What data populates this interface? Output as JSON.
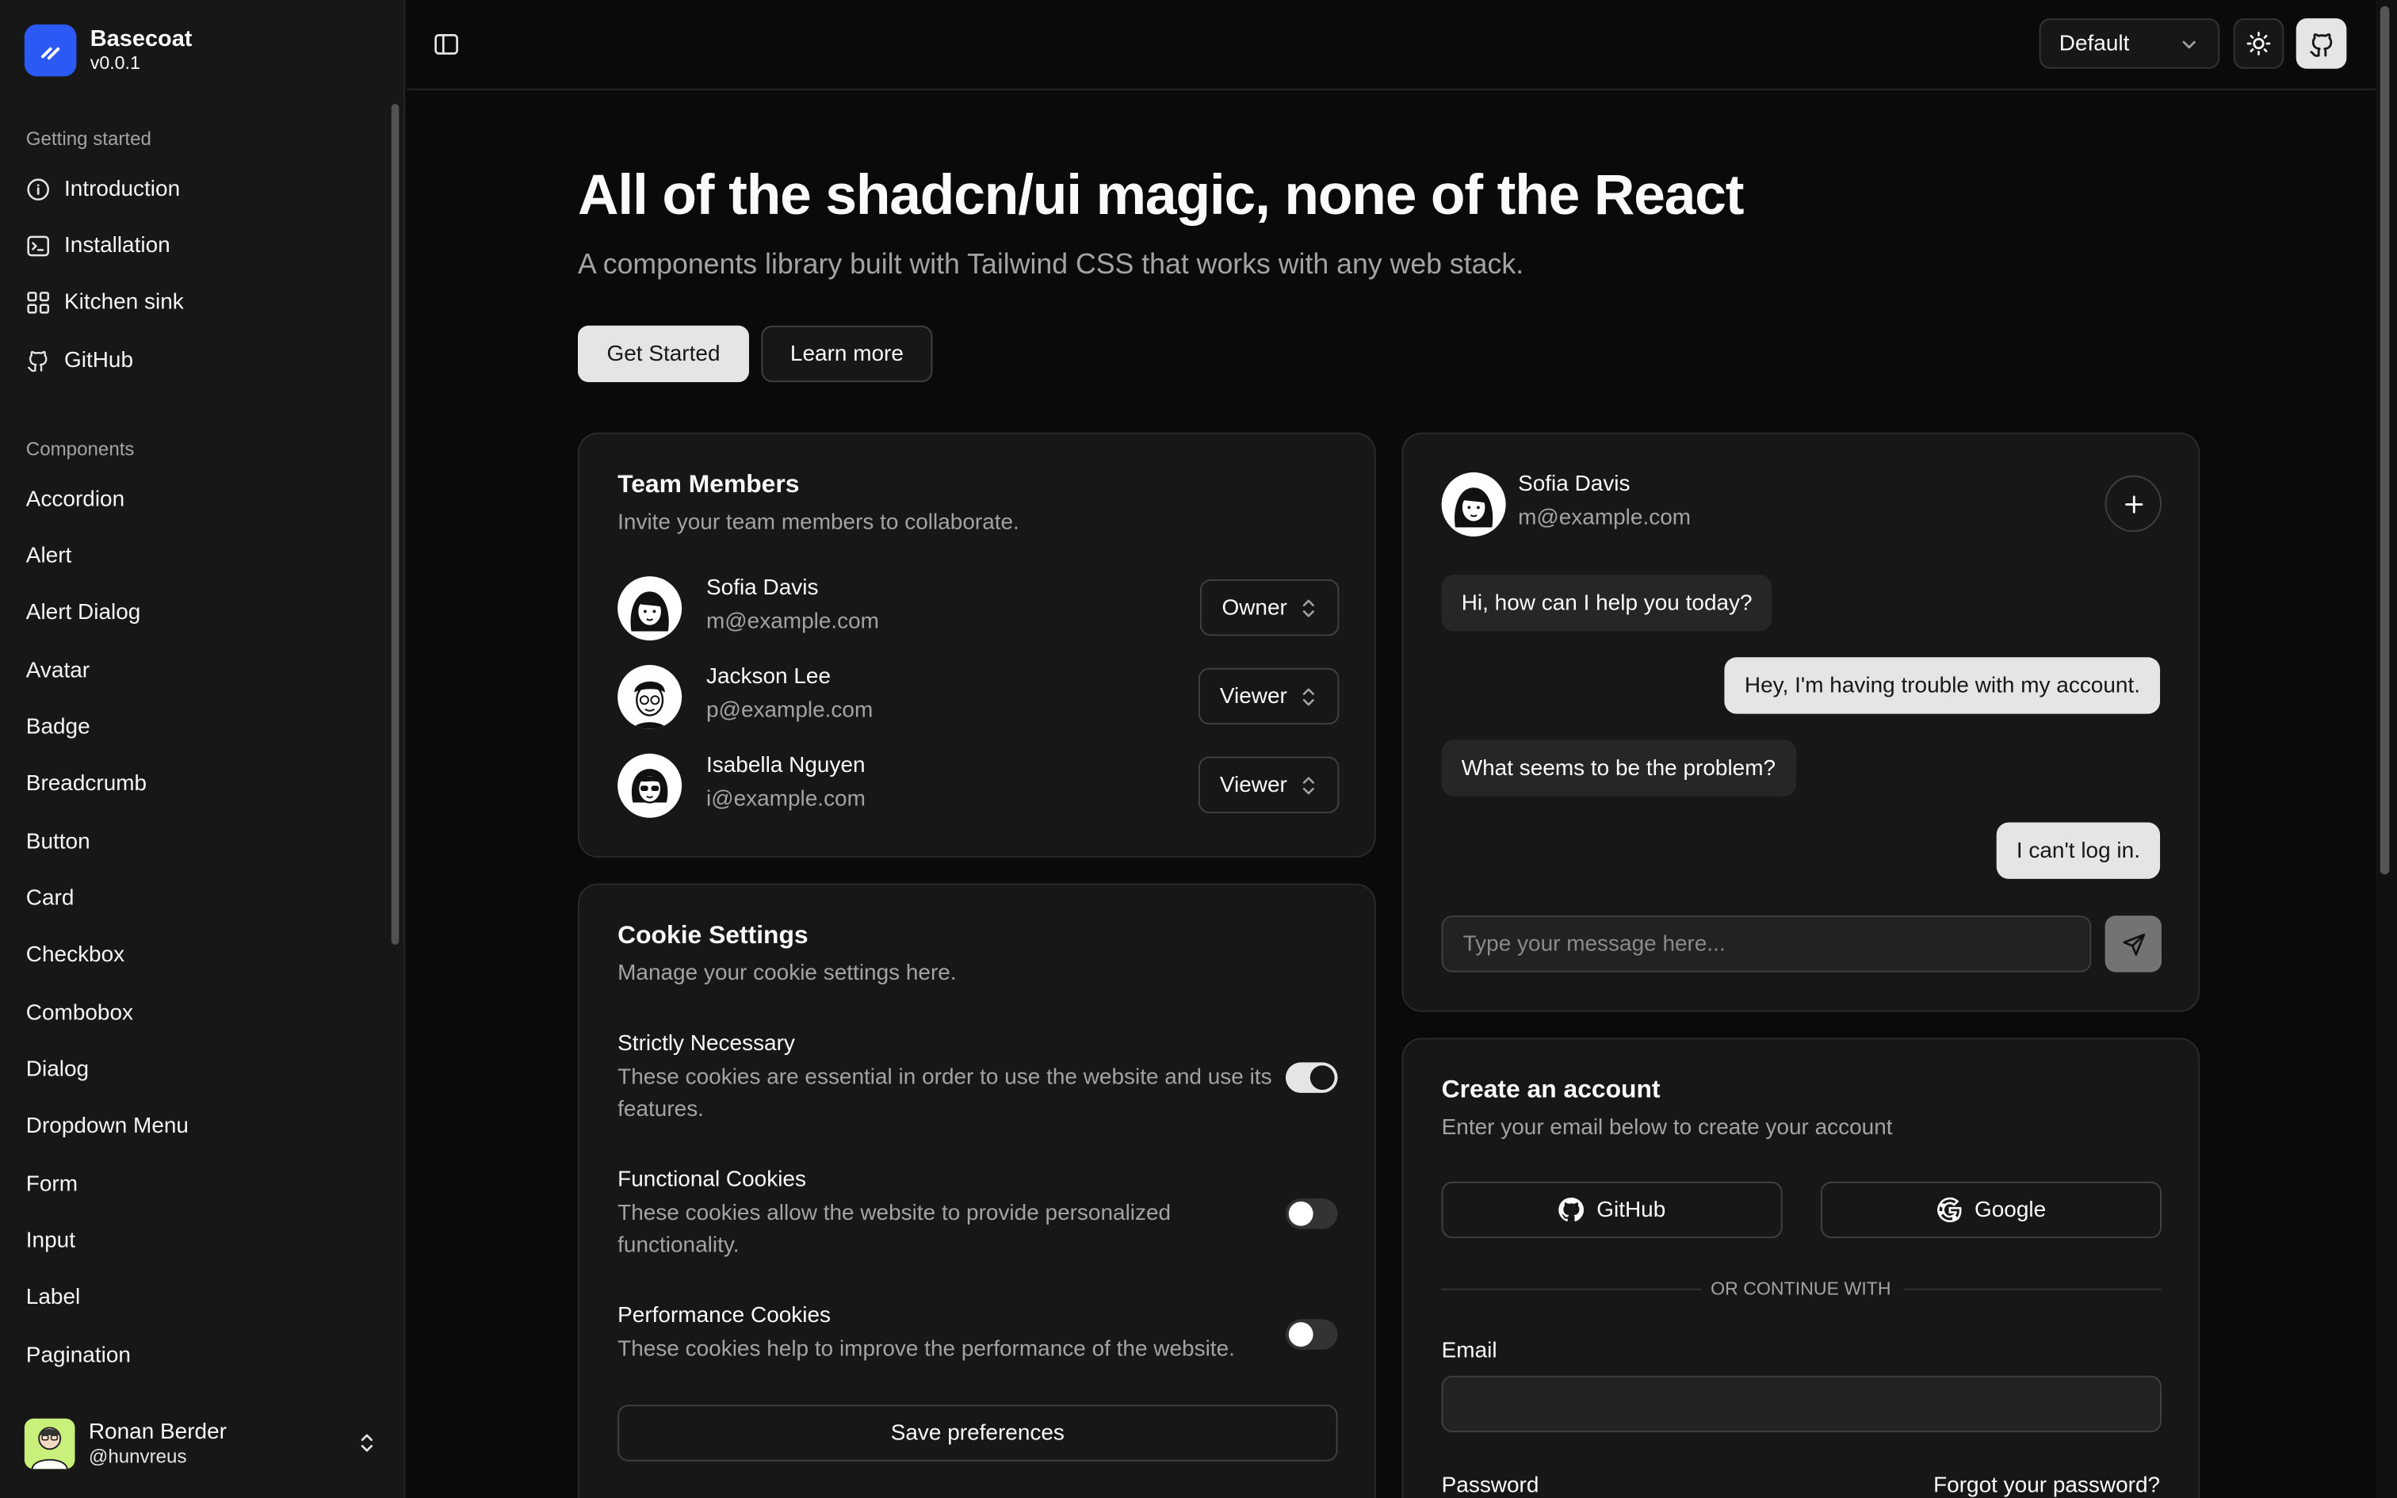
{
  "brand": {
    "name": "Basecoat",
    "version": "v0.0.1"
  },
  "sidebar": {
    "groups": [
      {
        "label": "Getting started",
        "items": [
          "Introduction",
          "Installation",
          "Kitchen sink",
          "GitHub"
        ]
      },
      {
        "label": "Components",
        "items": [
          "Accordion",
          "Alert",
          "Alert Dialog",
          "Avatar",
          "Badge",
          "Breadcrumb",
          "Button",
          "Card",
          "Checkbox",
          "Combobox",
          "Dialog",
          "Dropdown Menu",
          "Form",
          "Input",
          "Label",
          "Pagination"
        ]
      }
    ],
    "user": {
      "name": "Ronan Berder",
      "handle": "@hunvreus"
    }
  },
  "header": {
    "theme_select": "Default"
  },
  "hero": {
    "title": "All of the shadcn/ui magic, none of the React",
    "subtitle": "A components library built with Tailwind CSS that works with any web stack.",
    "primary_button": "Get Started",
    "secondary_button": "Learn more"
  },
  "team": {
    "title": "Team Members",
    "description": "Invite your team members to collaborate.",
    "members": [
      {
        "name": "Sofia Davis",
        "email": "m@example.com",
        "role": "Owner"
      },
      {
        "name": "Jackson Lee",
        "email": "p@example.com",
        "role": "Viewer"
      },
      {
        "name": "Isabella Nguyen",
        "email": "i@example.com",
        "role": "Viewer"
      }
    ]
  },
  "cookies": {
    "title": "Cookie Settings",
    "description": "Manage your cookie settings here.",
    "items": [
      {
        "title": "Strictly Necessary",
        "description": "These cookies are essential in order to use the website and use its features.",
        "enabled": true
      },
      {
        "title": "Functional Cookies",
        "description": "These cookies allow the website to provide personalized functionality.",
        "enabled": false
      },
      {
        "title": "Performance Cookies",
        "description": "These cookies help to improve the performance of the website.",
        "enabled": false
      }
    ],
    "save_label": "Save preferences"
  },
  "chat": {
    "contact_name": "Sofia Davis",
    "contact_email": "m@example.com",
    "messages": [
      {
        "from": "agent",
        "text": "Hi, how can I help you today?"
      },
      {
        "from": "user",
        "text": "Hey, I'm having trouble with my account."
      },
      {
        "from": "agent",
        "text": "What seems to be the problem?"
      },
      {
        "from": "user",
        "text": "I can't log in."
      }
    ],
    "input_placeholder": "Type your message here..."
  },
  "account": {
    "title": "Create an account",
    "description": "Enter your email below to create your account",
    "github_label": "GitHub",
    "google_label": "Google",
    "separator": "OR CONTINUE WITH",
    "email_label": "Email",
    "password_label": "Password",
    "forgot_label": "Forgot your password?"
  }
}
